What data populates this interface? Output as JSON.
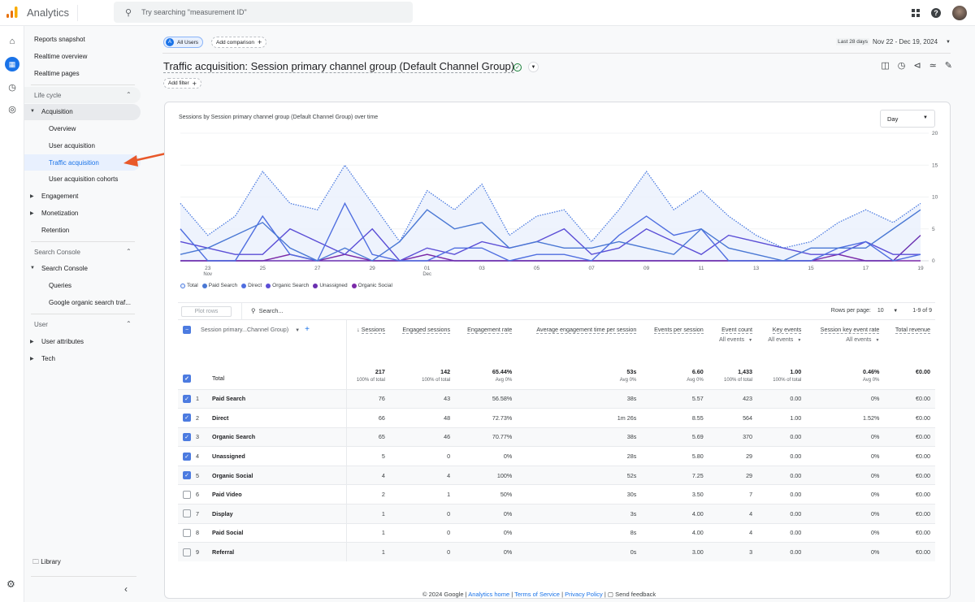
{
  "app": {
    "title": "Analytics",
    "search_placeholder": "Try searching \"measurement ID\""
  },
  "rail": {
    "icons": [
      "home-icon",
      "reports-icon",
      "explore-icon",
      "advertising-icon"
    ]
  },
  "nav": {
    "top_items": [
      "Reports snapshot",
      "Realtime overview",
      "Realtime pages"
    ],
    "lifecycle": {
      "label": "Life cycle",
      "acquisition": "Acquisition",
      "sub": [
        "Overview",
        "User acquisition",
        "Traffic acquisition",
        "User acquisition cohorts"
      ],
      "engagement": "Engagement",
      "monetization": "Monetization",
      "retention": "Retention"
    },
    "search_console": {
      "label": "Search Console",
      "group": "Search Console",
      "sub": [
        "Queries",
        "Google organic search traf..."
      ]
    },
    "user": {
      "label": "User",
      "items": [
        "User attributes",
        "Tech"
      ]
    },
    "library": "Library"
  },
  "header": {
    "segment": "All Users",
    "segment_letter": "A",
    "add_comparison": "Add comparison",
    "date_badge": "Last 28 days",
    "date_range": "Nov 22 - Dec 19, 2024",
    "title": "Traffic acquisition: Session primary channel group (Default Channel Group)",
    "add_filter": "Add filter"
  },
  "chart_card": {
    "title": "Sessions by Session primary channel group (Default Channel Group) over time",
    "granularity": "Day"
  },
  "chart_data": {
    "type": "line",
    "title": "Sessions by Session primary channel group (Default Channel Group) over time",
    "x": [
      "22",
      "23",
      "24",
      "25",
      "26",
      "27",
      "28",
      "29",
      "30",
      "01",
      "02",
      "03",
      "04",
      "05",
      "06",
      "07",
      "08",
      "09",
      "10",
      "11",
      "12",
      "13",
      "14",
      "15",
      "16",
      "17",
      "18",
      "19"
    ],
    "x_ticks": [
      {
        "i": 1,
        "label": "23",
        "sub": "Nov"
      },
      {
        "i": 3,
        "label": "25"
      },
      {
        "i": 5,
        "label": "27"
      },
      {
        "i": 7,
        "label": "29"
      },
      {
        "i": 9,
        "label": "01",
        "sub": "Dec"
      },
      {
        "i": 11,
        "label": "03"
      },
      {
        "i": 13,
        "label": "05"
      },
      {
        "i": 15,
        "label": "07"
      },
      {
        "i": 17,
        "label": "09"
      },
      {
        "i": 19,
        "label": "11"
      },
      {
        "i": 21,
        "label": "13"
      },
      {
        "i": 23,
        "label": "15"
      },
      {
        "i": 25,
        "label": "17"
      },
      {
        "i": 27,
        "label": "19"
      }
    ],
    "ylim": [
      0,
      20
    ],
    "y_ticks": [
      0,
      5,
      10,
      15,
      20
    ],
    "legend_position": "bottom-left",
    "series": [
      {
        "name": "Total",
        "color": "#4c7be0",
        "style": "dotted",
        "values": [
          9,
          4,
          7,
          14,
          9,
          8,
          15,
          9,
          3,
          11,
          8,
          12,
          4,
          7,
          8,
          3,
          8,
          14,
          8,
          11,
          7,
          4,
          2,
          3,
          6,
          8,
          6,
          9
        ]
      },
      {
        "name": "Paid Search",
        "color": "#4a78d4",
        "style": "solid",
        "values": [
          1,
          2,
          4,
          6,
          2,
          0,
          2,
          0,
          3,
          8,
          5,
          6,
          2,
          3,
          2,
          2,
          3,
          2,
          1,
          5,
          2,
          1,
          0,
          2,
          2,
          2,
          5,
          8
        ]
      },
      {
        "name": "Direct",
        "color": "#4f6ee0",
        "style": "solid",
        "values": [
          5,
          0,
          0,
          7,
          1,
          0,
          9,
          1,
          0,
          0,
          2,
          2,
          0,
          1,
          1,
          0,
          4,
          7,
          4,
          5,
          0,
          0,
          0,
          0,
          2,
          3,
          0,
          1
        ]
      },
      {
        "name": "Organic Search",
        "color": "#5b4ed6",
        "style": "solid",
        "values": [
          3,
          2,
          1,
          1,
          5,
          3,
          1,
          5,
          0,
          2,
          1,
          3,
          2,
          3,
          5,
          1,
          2,
          5,
          3,
          1,
          4,
          3,
          2,
          1,
          1,
          3,
          1,
          1
        ]
      },
      {
        "name": "Unassigned",
        "color": "#6a2fb0",
        "style": "solid",
        "values": [
          0,
          0,
          0,
          0,
          0,
          0,
          0,
          0,
          0,
          0,
          0,
          0,
          0,
          0,
          0,
          0,
          0,
          0,
          0,
          0,
          0,
          0,
          0,
          0,
          0,
          0,
          0,
          4
        ]
      },
      {
        "name": "Organic Social",
        "color": "#7b2aa8",
        "style": "solid",
        "values": [
          0,
          0,
          0,
          0,
          1,
          0,
          1,
          0,
          0,
          1,
          0,
          0,
          0,
          0,
          0,
          0,
          0,
          0,
          0,
          0,
          0,
          0,
          0,
          0,
          1,
          0,
          0,
          0
        ]
      }
    ]
  },
  "table": {
    "plot_rows": "Plot rows",
    "search_placeholder": "Search...",
    "rows_per_page_label": "Rows per page:",
    "rows_per_page": "10",
    "pagination": "1-9 of 9",
    "dimension_header": "Session primary...Channel Group)",
    "columns": [
      {
        "label": "Sessions",
        "sort": "↓"
      },
      {
        "label": "Engaged sessions"
      },
      {
        "label": "Engagement rate"
      },
      {
        "label": "Average engagement time per session"
      },
      {
        "label": "Events per session"
      },
      {
        "label": "Event count",
        "sub": "All events"
      },
      {
        "label": "Key events",
        "sub": "All events"
      },
      {
        "label": "Session key event rate",
        "sub": "All events"
      },
      {
        "label": "Total revenue"
      }
    ],
    "total": {
      "label": "Total",
      "values": [
        [
          "217",
          "100% of total"
        ],
        [
          "142",
          "100% of total"
        ],
        [
          "65.44%",
          "Avg 0%"
        ],
        [
          "53s",
          "Avg 0%"
        ],
        [
          "6.60",
          "Avg 0%"
        ],
        [
          "1,433",
          "100% of total"
        ],
        [
          "1.00",
          "100% of total"
        ],
        [
          "0.46%",
          "Avg 0%"
        ],
        [
          "€0.00",
          ""
        ]
      ]
    },
    "rows": [
      {
        "n": "1",
        "name": "Paid Search",
        "checked": true,
        "v": [
          "76",
          "43",
          "56.58%",
          "38s",
          "5.57",
          "423",
          "0.00",
          "0%",
          "€0.00"
        ]
      },
      {
        "n": "2",
        "name": "Direct",
        "checked": true,
        "v": [
          "66",
          "48",
          "72.73%",
          "1m 26s",
          "8.55",
          "564",
          "1.00",
          "1.52%",
          "€0.00"
        ]
      },
      {
        "n": "3",
        "name": "Organic Search",
        "checked": true,
        "v": [
          "65",
          "46",
          "70.77%",
          "38s",
          "5.69",
          "370",
          "0.00",
          "0%",
          "€0.00"
        ]
      },
      {
        "n": "4",
        "name": "Unassigned",
        "checked": true,
        "v": [
          "5",
          "0",
          "0%",
          "28s",
          "5.80",
          "29",
          "0.00",
          "0%",
          "€0.00"
        ]
      },
      {
        "n": "5",
        "name": "Organic Social",
        "checked": true,
        "v": [
          "4",
          "4",
          "100%",
          "52s",
          "7.25",
          "29",
          "0.00",
          "0%",
          "€0.00"
        ]
      },
      {
        "n": "6",
        "name": "Paid Video",
        "checked": false,
        "v": [
          "2",
          "1",
          "50%",
          "30s",
          "3.50",
          "7",
          "0.00",
          "0%",
          "€0.00"
        ]
      },
      {
        "n": "7",
        "name": "Display",
        "checked": false,
        "v": [
          "1",
          "0",
          "0%",
          "3s",
          "4.00",
          "4",
          "0.00",
          "0%",
          "€0.00"
        ]
      },
      {
        "n": "8",
        "name": "Paid Social",
        "checked": false,
        "v": [
          "1",
          "0",
          "0%",
          "8s",
          "4.00",
          "4",
          "0.00",
          "0%",
          "€0.00"
        ]
      },
      {
        "n": "9",
        "name": "Referral",
        "checked": false,
        "v": [
          "1",
          "0",
          "0%",
          "0s",
          "3.00",
          "3",
          "0.00",
          "0%",
          "€0.00"
        ]
      }
    ]
  },
  "footer": {
    "copyright": "© 2024 Google |",
    "links": [
      "Analytics home",
      "Terms of Service",
      "Privacy Policy"
    ],
    "feedback": "Send feedback"
  },
  "colors": {
    "accent": "#1a73e8",
    "annotation_arrow": "#e8582a"
  }
}
